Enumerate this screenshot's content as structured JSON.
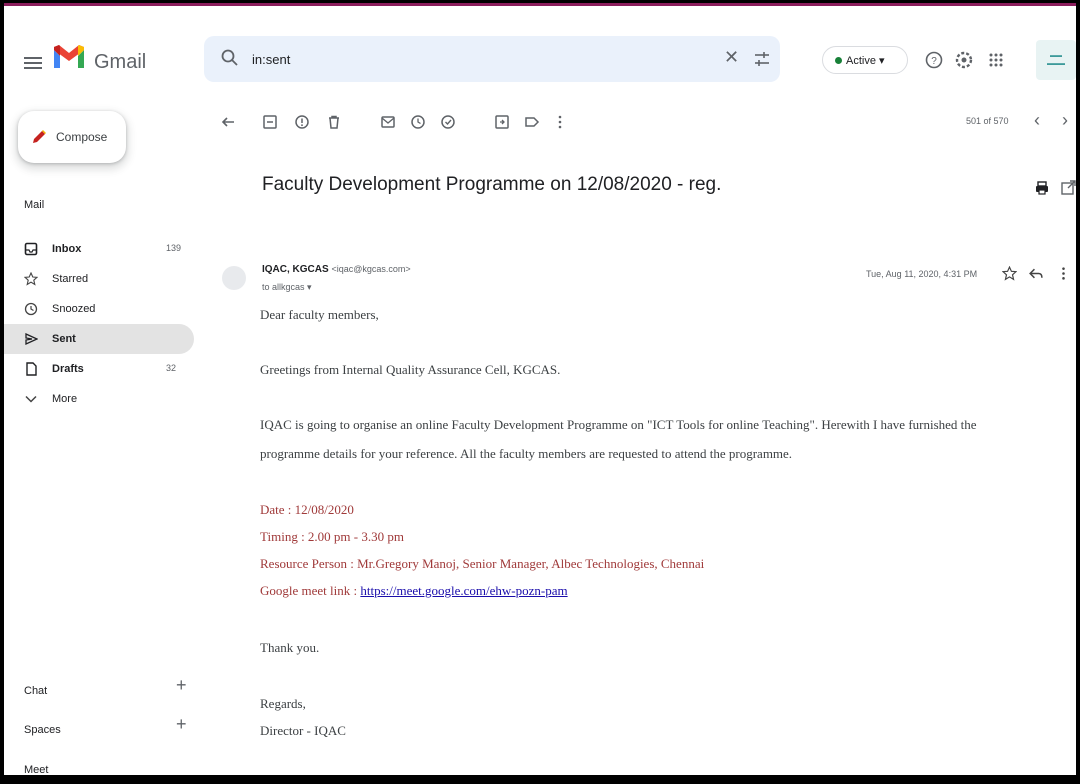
{
  "app": {
    "name": "Gmail",
    "search_value": "in:sent",
    "status": "Active",
    "colors": {
      "accent": "#8b1d5c",
      "active_green": "#188038",
      "link": "#1a0dab",
      "details_red": "#a03a3a"
    }
  },
  "sidebar": {
    "compose_label": "Compose",
    "mail_heading": "Mail",
    "items": [
      {
        "label": "Inbox",
        "icon": "inbox-icon",
        "count": "139",
        "active": false
      },
      {
        "label": "Starred",
        "icon": "star-icon",
        "count": "",
        "active": false
      },
      {
        "label": "Snoozed",
        "icon": "clock-icon",
        "count": "",
        "active": false
      },
      {
        "label": "Sent",
        "icon": "send-icon",
        "count": "",
        "active": true
      },
      {
        "label": "Drafts",
        "icon": "draft-icon",
        "count": "32",
        "active": false
      },
      {
        "label": "More",
        "icon": "chevron-down-icon",
        "count": "",
        "active": false
      }
    ],
    "chat_heading": "Chat",
    "spaces_heading": "Spaces",
    "meet_heading": "Meet"
  },
  "toolbar": {
    "pager": "501 of 570"
  },
  "message": {
    "subject": "Faculty Development Programme on 12/08/2020 - reg.",
    "sender_name": "IQAC, KGCAS",
    "sender_email": "<iqac@kgcas.com>",
    "recipient": "to allkgcas ▾",
    "date": "Tue, Aug 11, 2020, 4:31 PM",
    "greeting": "Dear faculty members,",
    "intro": "Greetings from Internal Quality Assurance Cell, KGCAS.",
    "para1": "IQAC is going to organise an online Faculty Development Programme on \"ICT Tools for online Teaching\". Herewith I have furnished the",
    "para2": "programme details for your reference. All the faculty members are requested to attend the programme.",
    "date_line": "Date : 12/08/2020",
    "timing_line": "Timing : 2.00 pm - 3.30 pm",
    "resource_line": "Resource Person : Mr.Gregory Manoj, Senior Manager, Albec Technologies, Chennai",
    "meet_label": "Google meet link : ",
    "meet_link": "https://meet.google.com/ehw-pozn-pam",
    "thanks": "Thank you.",
    "regards": "Regards,",
    "signature": "Director - IQAC"
  }
}
